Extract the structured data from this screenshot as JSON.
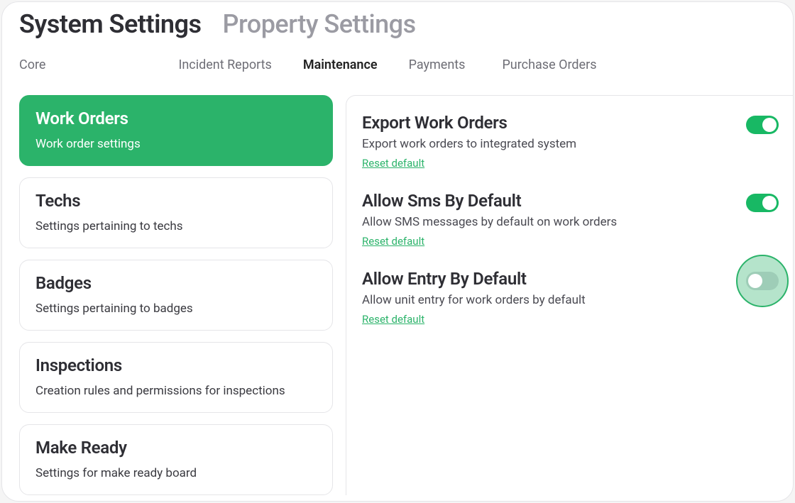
{
  "header": {
    "title_primary": "System Settings",
    "title_secondary": "Property Settings",
    "tabs": {
      "core": "Core",
      "incident": "Incident Reports",
      "maintenance": "Maintenance",
      "payments": "Payments",
      "po": "Purchase Orders",
      "active": "maintenance"
    }
  },
  "sidebar": {
    "items": [
      {
        "title": "Work Orders",
        "subtitle": "Work order settings",
        "active": true
      },
      {
        "title": "Techs",
        "subtitle": "Settings pertaining to techs",
        "active": false
      },
      {
        "title": "Badges",
        "subtitle": "Settings pertaining to badges",
        "active": false
      },
      {
        "title": "Inspections",
        "subtitle": "Creation rules and permissions for inspections",
        "active": false
      },
      {
        "title": "Make Ready",
        "subtitle": "Settings for make ready board",
        "active": false
      }
    ]
  },
  "settings": {
    "reset_label": "Reset default",
    "items": [
      {
        "title": "Export Work Orders",
        "desc": "Export work orders to integrated system",
        "on": true,
        "halo": false
      },
      {
        "title": "Allow Sms By Default",
        "desc": "Allow SMS messages by default on work orders",
        "on": true,
        "halo": false
      },
      {
        "title": "Allow Entry By Default",
        "desc": "Allow unit entry for work orders by default",
        "on": false,
        "halo": true
      }
    ]
  },
  "colors": {
    "accent": "#2bb36a"
  }
}
